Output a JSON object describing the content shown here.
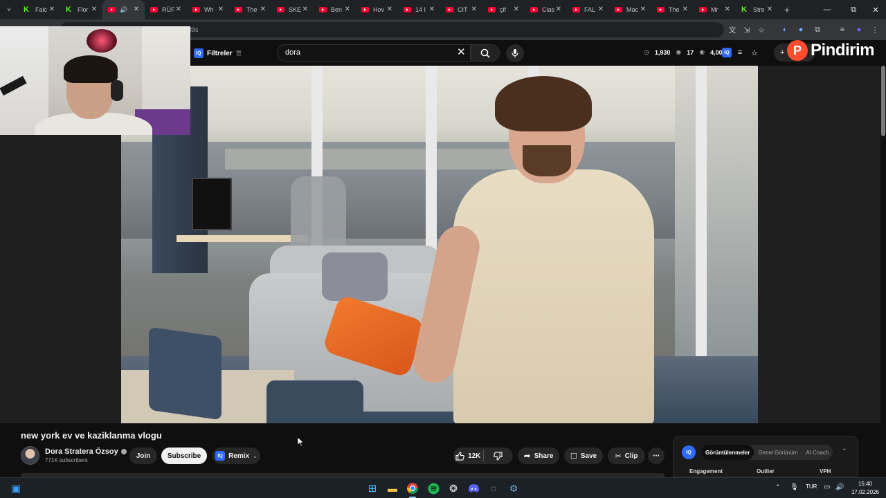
{
  "browser": {
    "tabs": [
      {
        "label": "Falc",
        "icon": "kick-icon"
      },
      {
        "label": "Flor",
        "icon": "kick-icon"
      },
      {
        "label": "",
        "icon": "youtube-icon",
        "active": true,
        "audio": true
      },
      {
        "label": "RÜF",
        "icon": "youtube-icon"
      },
      {
        "label": "Wh",
        "icon": "youtube-icon"
      },
      {
        "label": "The",
        "icon": "youtube-icon"
      },
      {
        "label": "SKE",
        "icon": "youtube-icon"
      },
      {
        "label": "Ben",
        "icon": "youtube-icon"
      },
      {
        "label": "Hov",
        "icon": "youtube-icon"
      },
      {
        "label": "14 I",
        "icon": "youtube-icon"
      },
      {
        "label": "CIT",
        "icon": "youtube-icon"
      },
      {
        "label": "çif",
        "icon": "youtube-icon"
      },
      {
        "label": "Clas",
        "icon": "youtube-icon"
      },
      {
        "label": "FAL",
        "icon": "youtube-icon"
      },
      {
        "label": "Mac",
        "icon": "youtube-icon"
      },
      {
        "label": "The",
        "icon": "youtube-icon"
      },
      {
        "label": "Mr",
        "icon": "youtube-icon"
      },
      {
        "label": "Stre",
        "icon": "kick-icon"
      }
    ],
    "close_glyph": "✕",
    "new_tab_glyph": "+",
    "tab_menu_glyph": "˅",
    "window_controls": {
      "minimize": "—",
      "restore": "⧉",
      "close": "✕"
    },
    "address_text": "89s"
  },
  "youtube": {
    "filters_label": "Filtreler",
    "search_value": "dora",
    "clear_glyph": "✕",
    "stats": {
      "views": "1,930",
      "watching": "17",
      "total": "4,009"
    },
    "create_label": "+",
    "pindirim_letter": "P",
    "pindirim_text": "Pindirim",
    "video_title": "new york ev ve kaziklanma vlogu",
    "channel_name": "Dora Stratera Özsoy",
    "subscribers": "771K subscribers",
    "join_label": "Join",
    "subscribe_label": "Subscribe",
    "remix_label": "Remix",
    "remix_badge": "IQ",
    "likes": "12K",
    "share_label": "Share",
    "save_label": "Save",
    "clip_label": "Clip",
    "more_glyph": "⋯",
    "filter_badge": "IQ"
  },
  "vidiq_panel": {
    "logo": "IQ",
    "tabs": [
      "Görüntülenmeler",
      "Genel Görünüm",
      "AI Coach"
    ],
    "active_tab": 0,
    "columns": [
      "Engagement",
      "Outlier",
      "VPH"
    ]
  },
  "taskbar": {
    "language": "TUR",
    "time": "15:40",
    "date": "17.02.2026"
  },
  "colors": {
    "youtube_red": "#ff0033",
    "kick_green": "#53fc18",
    "vidiq_blue": "#2f6bff",
    "pindirim_orange": "#ff4d2e"
  }
}
